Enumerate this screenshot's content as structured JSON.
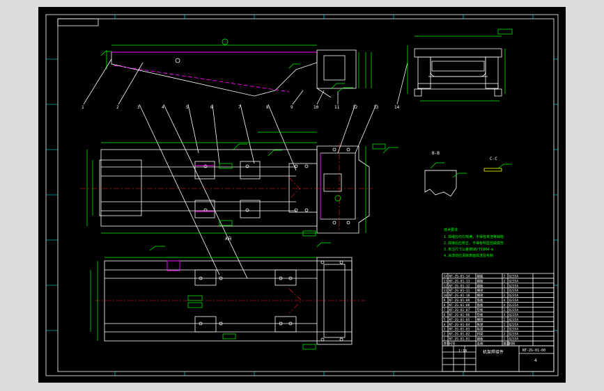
{
  "drawing": {
    "view_label": "A向",
    "section_labels": [
      "B-B",
      "C-C"
    ],
    "part_balloons": [
      "1",
      "2",
      "3",
      "4",
      "5",
      "6",
      "7",
      "8",
      "9",
      "10",
      "11",
      "12",
      "13",
      "14"
    ],
    "notes_title": "技术要求",
    "notes": [
      "1.焊缝应均匀饱满，不得有夹渣等缺陷",
      "2.焊接后应校正，不得有明显扭曲变形",
      "3.未注尺寸公差按GB/T1804-m",
      "4.涂漆前应清除表面焊渣及毛刺"
    ],
    "bom_rows": [
      {
        "no": "14",
        "code": "NT-ZG-01-14",
        "name": "钢板",
        "qty": "2",
        "mat": "Q235A"
      },
      {
        "no": "13",
        "code": "NT-ZG-01-13",
        "name": "钢板",
        "qty": "2",
        "mat": "Q235A"
      },
      {
        "no": "12",
        "code": "NT-ZG-01-12",
        "name": "钢板",
        "qty": "1",
        "mat": "Q235A"
      },
      {
        "no": "11",
        "code": "NT-ZG-01-11",
        "name": "横梁",
        "qty": "1",
        "mat": "Q235A"
      },
      {
        "no": "10",
        "code": "NT-ZG-01-10",
        "name": "横梁",
        "qty": "2",
        "mat": "Q235A"
      },
      {
        "no": "9",
        "code": "NT-ZG-01-09",
        "name": "筋板",
        "qty": "4",
        "mat": "Q235A"
      },
      {
        "no": "8",
        "code": "NT-ZG-01-08",
        "name": "筋板",
        "qty": "4",
        "mat": "Q235A"
      },
      {
        "no": "7",
        "code": "NT-ZG-01-07",
        "name": "垫板",
        "qty": "2",
        "mat": "Q235A"
      },
      {
        "no": "6",
        "code": "NT-ZG-01-06",
        "name": "垫板",
        "qty": "4",
        "mat": "Q235A"
      },
      {
        "no": "5",
        "code": "NT-ZG-01-05",
        "name": "横梁",
        "qty": "2",
        "mat": "Q235A"
      },
      {
        "no": "4",
        "code": "NT-ZG-01-04",
        "name": "纵梁",
        "qty": "2",
        "mat": "Q235A"
      },
      {
        "no": "3",
        "code": "NT-ZG-01-03",
        "name": "纵梁",
        "qty": "2",
        "mat": "Q235A"
      },
      {
        "no": "2",
        "code": "NT-ZG-01-02",
        "name": "斜梁",
        "qty": "2",
        "mat": "Q235A"
      },
      {
        "no": "1",
        "code": "NT-ZG-01-01",
        "name": "钢板",
        "qty": "1",
        "mat": "Q235A"
      }
    ],
    "bom_header": {
      "no": "序号",
      "code": "代号",
      "name": "名称",
      "qty": "数量",
      "mat": "材料"
    },
    "title_block": {
      "title": "机架焊接件",
      "drawing_no": "NT-ZG-01-00",
      "scale": "1:10",
      "sheet": "4",
      "side_label": "总重"
    }
  },
  "colors": {
    "background": "#000000",
    "frame": "#ffffff",
    "grid": "#00ffff",
    "dimension": "#00ff00",
    "weld": "#ff00ff",
    "centerline": "#ff2020",
    "outer_bg": "#dcdcdc"
  }
}
